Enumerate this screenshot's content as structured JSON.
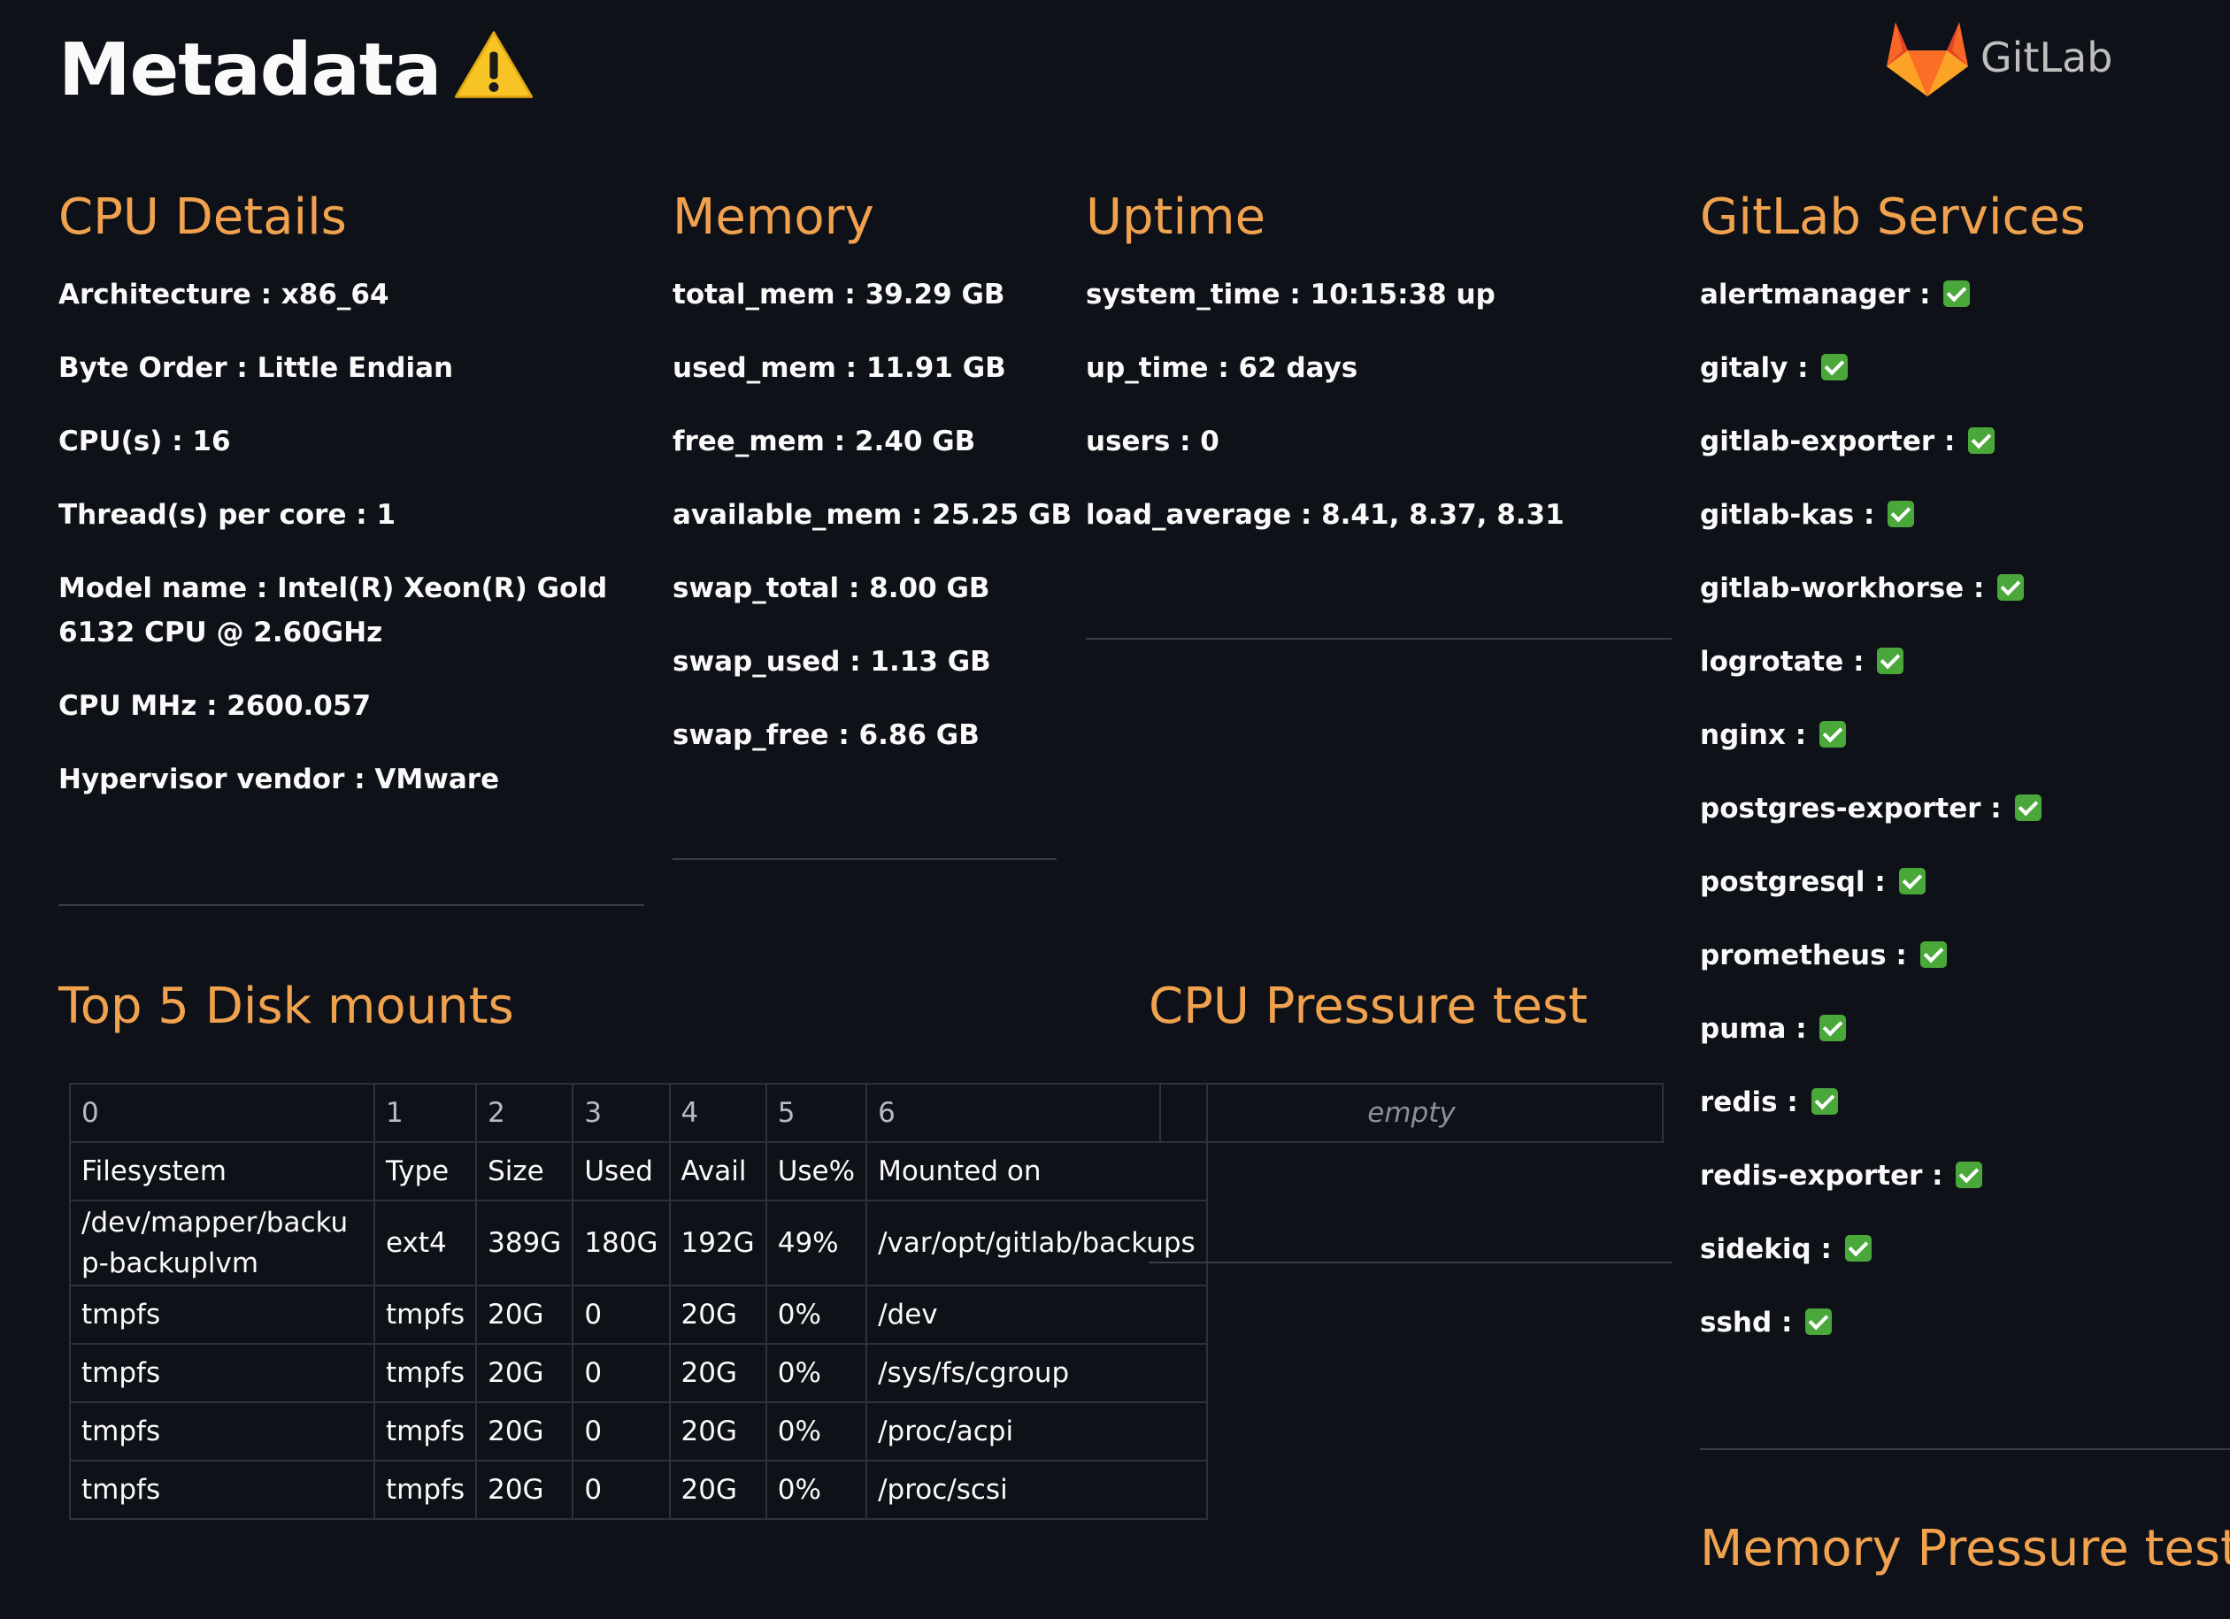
{
  "header": {
    "title": "Metadata",
    "warning_icon": "warning-icon",
    "logo_text": "GitLab",
    "logo_icon": "gitlab-tanuki-icon"
  },
  "cpu": {
    "title": "CPU Details",
    "items": [
      "Architecture : x86_64",
      "Byte Order : Little Endian",
      "CPU(s) : 16",
      "Thread(s) per core : 1",
      "Model name : Intel(R) Xeon(R) Gold 6132 CPU @ 2.60GHz",
      "CPU MHz : 2600.057",
      "Hypervisor vendor : VMware"
    ]
  },
  "memory": {
    "title": "Memory",
    "items": [
      "total_mem : 39.29 GB",
      "used_mem : 11.91 GB",
      "free_mem : 2.40 GB",
      "available_mem : 25.25 GB",
      "swap_total : 8.00 GB",
      "swap_used : 1.13 GB",
      "swap_free : 6.86 GB"
    ]
  },
  "uptime": {
    "title": "Uptime",
    "items": [
      "system_time : 10:15:38 up",
      "up_time : 62 days",
      "users : 0",
      "load_average : 8.41, 8.37, 8.31"
    ]
  },
  "services": {
    "title": "GitLab Services",
    "status_icon": "check-mark-icon",
    "items": [
      "alertmanager :",
      "gitaly :",
      "gitlab-exporter :",
      "gitlab-kas :",
      "gitlab-workhorse :",
      "logrotate :",
      "nginx :",
      "postgres-exporter :",
      "postgresql :",
      "prometheus :",
      "puma :",
      "redis :",
      "redis-exporter :",
      "sidekiq :",
      "sshd :"
    ]
  },
  "disk": {
    "title": "Top 5 Disk mounts",
    "columns": [
      "0",
      "1",
      "2",
      "3",
      "4",
      "5",
      "6"
    ],
    "rows": [
      [
        "Filesystem",
        "Type",
        "Size",
        "Used",
        "Avail",
        "Use%",
        "Mounted on"
      ],
      [
        "/dev/mapper/backup-backuplvm",
        "ext4",
        "389G",
        "180G",
        "192G",
        "49%",
        "/var/opt/gitlab/backups"
      ],
      [
        "tmpfs",
        "tmpfs",
        "20G",
        "0",
        "20G",
        "0%",
        "/dev"
      ],
      [
        "tmpfs",
        "tmpfs",
        "20G",
        "0",
        "20G",
        "0%",
        "/sys/fs/cgroup"
      ],
      [
        "tmpfs",
        "tmpfs",
        "20G",
        "0",
        "20G",
        "0%",
        "/proc/acpi"
      ],
      [
        "tmpfs",
        "tmpfs",
        "20G",
        "0",
        "20G",
        "0%",
        "/proc/scsi"
      ]
    ]
  },
  "cpu_pressure": {
    "title": "CPU Pressure test",
    "empty_text": "empty"
  },
  "memory_pressure": {
    "title": "Memory Pressure test"
  },
  "colors": {
    "background": "#0e1117",
    "accent": "#f0a24f",
    "text": "#fafafa",
    "check": "#4aa83b"
  }
}
